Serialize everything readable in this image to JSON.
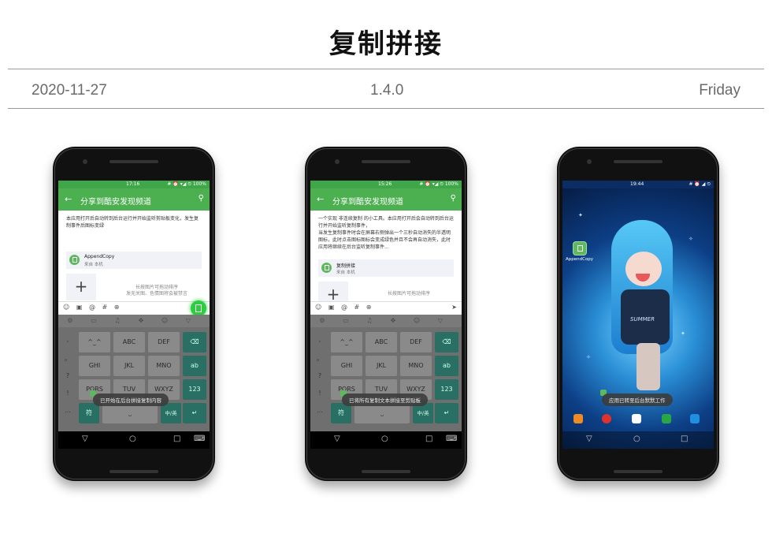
{
  "header": {
    "title": "复制拼接"
  },
  "meta": {
    "date": "2020-11-27",
    "version": "1.4.0",
    "day": "Friday"
  },
  "screens": [
    {
      "status_time": "17:16",
      "status_icons": "# ⏰ ▾◢ ⏲ 100%",
      "appbar_title": "分享到酷安发现频道",
      "description": "本应用打开后自动转到后台运行并开始监听剪贴板变化，发生复制事件后图标变绿",
      "card": {
        "name": "AppendCopy",
        "source": "来自 本机"
      },
      "hint": "长按图片可拖动排序\n发无关图、色情图将会被禁言",
      "toast": "已开始在后台拼接复制内容",
      "keys": {
        "row1": [
          "^_^",
          "ABC",
          "DEF"
        ],
        "row2": [
          "GHI",
          "JKL",
          "MNO"
        ],
        "row3": [
          "PQRS",
          "TUV",
          "WXYZ"
        ],
        "fn_ab": "ab",
        "fn_123": "123",
        "fn_fu": "符",
        "fn_zh": "中/英",
        "side": [
          ",",
          "。",
          "?",
          "!",
          "..."
        ]
      }
    },
    {
      "status_time": "15:26",
      "status_icons": "# ⏰ ▾◢ ⏲ 100%",
      "appbar_title": "分享到酷安发现频道",
      "description": "一个实现 非连续复制 的小工具。本应用打开后会自动转到后台运行并开始监听复制事件，\n当发生复制事件时会在屏幕右侧弹出一个三秒自动消失的半透明图标，此时点击图标图标会变成绿色并且不会再自动消失，此时应用将继续在后台监听复制事件...",
      "card": {
        "name": "复制拼接",
        "source": "来自 本机"
      },
      "hint": "长按图片可拖动排序",
      "toast": "已将所有复制文本拼接至剪贴板",
      "keys": {
        "row1": [
          "^_^",
          "ABC",
          "DEF"
        ],
        "row2": [
          "GHI",
          "JKL",
          "MNO"
        ],
        "row3": [
          "PQRS",
          "TUV",
          "WXYZ"
        ],
        "fn_ab": "ab",
        "fn_123": "123",
        "fn_fu": "符",
        "fn_zh": "中/英",
        "side": [
          ",",
          "。",
          "?",
          "!",
          "..."
        ]
      }
    },
    {
      "status_time": "19:44",
      "status_icons": "# ⏰ ◢ ⏲",
      "app_label": "AppendCopy",
      "shirt_text": "SUMMER",
      "toast": "应用已转至后台默默工作"
    }
  ],
  "icons": {
    "back": "←",
    "search": "⚲",
    "nav_back": "▽",
    "nav_home": "○",
    "nav_recent": "□",
    "nav_kbd": "⌨",
    "emoji": "☺",
    "image": "▣",
    "at": "@",
    "hash": "#",
    "plus": "⊕",
    "send": "➤",
    "add": "+"
  },
  "colors": {
    "accent": "#4caf50",
    "statusbar": "#3fa64a",
    "fab": "#2ecc40",
    "keyboard": "#6f6f6f",
    "func_key": "#2a6f63"
  }
}
